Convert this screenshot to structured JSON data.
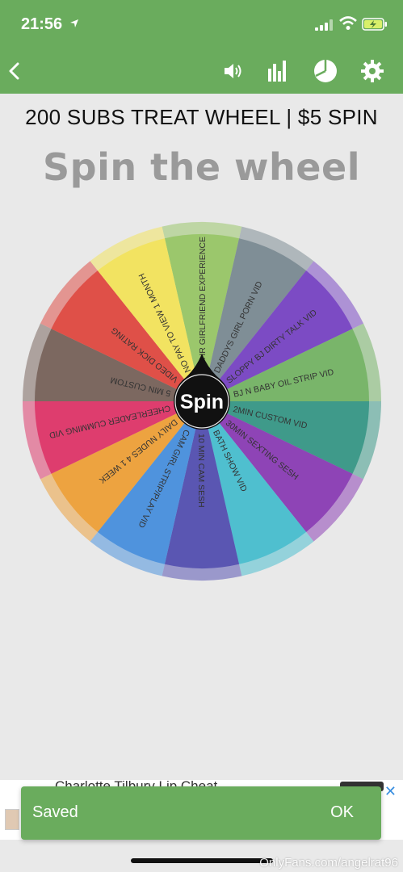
{
  "status_bar": {
    "time": "21:56"
  },
  "wheel": {
    "title": "200 SUBS TREAT WHEEL | $5 SPIN",
    "heading": "Spin the wheel",
    "spin_label": "Spin",
    "segments": [
      {
        "label": "24HR GIRLFRIEND EXPERIENCE",
        "color": "#9bc76c"
      },
      {
        "label": "DADDYS GIRL PORN VID",
        "color": "#7f8e96"
      },
      {
        "label": "SLOPPY BJ DIRTY TALK VID",
        "color": "#7c4bc4"
      },
      {
        "label": "BJ N BABY OIL STRIP VID",
        "color": "#79b56a"
      },
      {
        "label": "2MIN CUSTOM VID",
        "color": "#3f9a8a"
      },
      {
        "label": "30MIN SEXTING SESH",
        "color": "#8e44b6"
      },
      {
        "label": "BATH SHOW VID",
        "color": "#4fbfcf"
      },
      {
        "label": "10 MIN CAM SESH",
        "color": "#5a56b2"
      },
      {
        "label": "CAM GIRL STRIP/PLAY VID",
        "color": "#4f93dd"
      },
      {
        "label": "DAILY NUDES 4 1 WEEK",
        "color": "#eda340"
      },
      {
        "label": "CHEERLEADER CUMMING VID",
        "color": "#de3d6e"
      },
      {
        "label": "5 MIN CUSTOM",
        "color": "#7c6860"
      },
      {
        "label": "VIDEO DICK RATING",
        "color": "#df5048"
      },
      {
        "label": "NO PAY TO VIEW 1 MONTH",
        "color": "#f2e361"
      }
    ]
  },
  "ad": {
    "text": "Charlotte Tilbury Lip Cheat"
  },
  "toast": {
    "message": "Saved",
    "action": "OK"
  },
  "watermark": "OnlyFans.com/angelrat96",
  "colors": {
    "app_green": "#6aac5d",
    "background": "#e9e9e9"
  }
}
